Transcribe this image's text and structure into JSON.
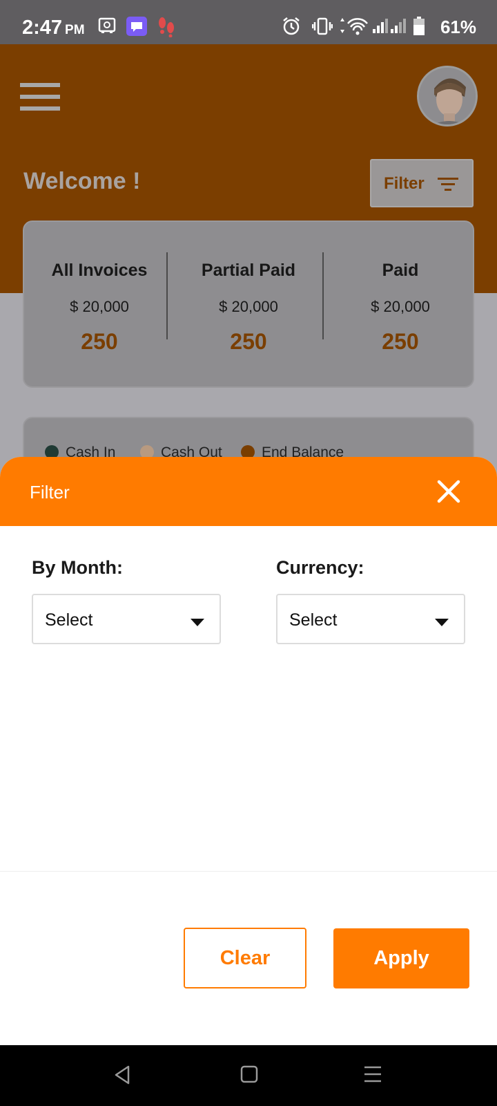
{
  "status_bar": {
    "time": "2:47",
    "ampm": "PM",
    "battery": "61%"
  },
  "header": {
    "welcome": "Welcome !",
    "filter_button": "Filter"
  },
  "stats": [
    {
      "title": "All Invoices",
      "amount": "$ 20,000",
      "count": "250"
    },
    {
      "title": "Partial Paid",
      "amount": "$ 20,000",
      "count": "250"
    },
    {
      "title": "Paid",
      "amount": "$ 20,000",
      "count": "250"
    }
  ],
  "legend": [
    {
      "label": "Cash In",
      "color": "#1f3a34"
    },
    {
      "label": "Cash Out",
      "color": "#b89a80"
    },
    {
      "label": "End Balance",
      "color": "#7a3e00"
    }
  ],
  "sheet": {
    "title": "Filter",
    "month_label": "By Month:",
    "month_value": "Select",
    "currency_label": "Currency:",
    "currency_value": "Select",
    "clear_label": "Clear",
    "apply_label": "Apply"
  },
  "colors": {
    "accent": "#ff7b00",
    "accent_dimmed": "#7a3e00"
  },
  "icons": [
    "alarm-icon",
    "vibrate-icon",
    "wifi-icon",
    "signal-icon",
    "battery-icon",
    "close-icon",
    "filter-lines-icon",
    "menu-icon",
    "back-icon",
    "home-icon",
    "recents-icon"
  ]
}
